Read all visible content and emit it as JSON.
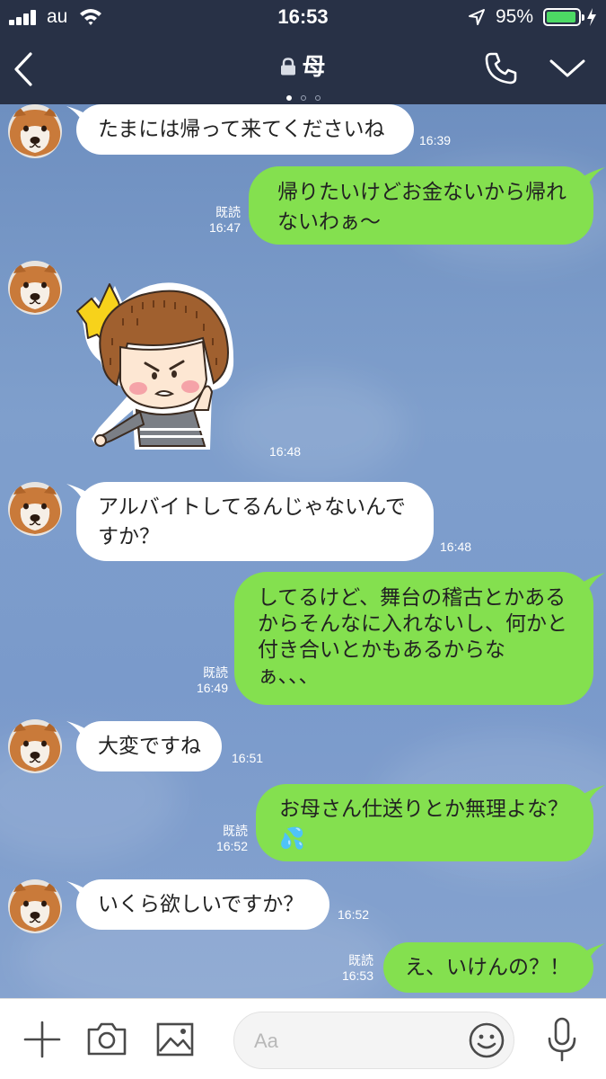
{
  "status_bar": {
    "carrier": "au",
    "time": "16:53",
    "battery_percent": "95%",
    "battery_level": 0.95,
    "battery_color": "#4cd964"
  },
  "header": {
    "title": "母",
    "page_indicator": {
      "count": 3,
      "active": 0
    },
    "icons": [
      "back-chevron-icon",
      "lock-icon",
      "phone-icon",
      "chevron-down-icon"
    ]
  },
  "colors": {
    "header_bg": "#283146",
    "chat_bg": "#7596c4",
    "incoming_bubble": "#ffffff",
    "outgoing_bubble": "#84e04f"
  },
  "messages": [
    {
      "side": "in",
      "type": "text",
      "text": "たまには帰って来てくださいね",
      "time": "16:39"
    },
    {
      "side": "out",
      "type": "text",
      "text": "帰りたいけどお金ないから帰れ\nないわぁ〜",
      "read": "既読",
      "time": "16:47"
    },
    {
      "side": "in",
      "type": "sticker",
      "sticker": "angry-girl-sticker",
      "time": "16:48"
    },
    {
      "side": "in",
      "type": "text",
      "text": "アルバイトしてるんじゃないんで\nすか？",
      "time": "16:48"
    },
    {
      "side": "out",
      "type": "text",
      "text": "してるけど、舞台の稽古とかある\nからそんなに入れないし、何かと\n付き合いとかもあるからな\nぁ、、、",
      "read": "既読",
      "time": "16:49"
    },
    {
      "side": "in",
      "type": "text",
      "text": "大変ですね",
      "time": "16:51"
    },
    {
      "side": "out",
      "type": "text",
      "text": "お母さん仕送りとか無理よな？\n💦",
      "read": "既読",
      "time": "16:52"
    },
    {
      "side": "in",
      "type": "text",
      "text": "いくら欲しいですか？",
      "time": "16:52"
    },
    {
      "side": "out",
      "type": "text",
      "text": "え、いけんの？！",
      "read": "既読",
      "time": "16:53"
    }
  ],
  "input_bar": {
    "placeholder": "Aa",
    "icons": [
      "plus-icon",
      "camera-icon",
      "image-icon",
      "emoji-icon",
      "microphone-icon"
    ]
  }
}
